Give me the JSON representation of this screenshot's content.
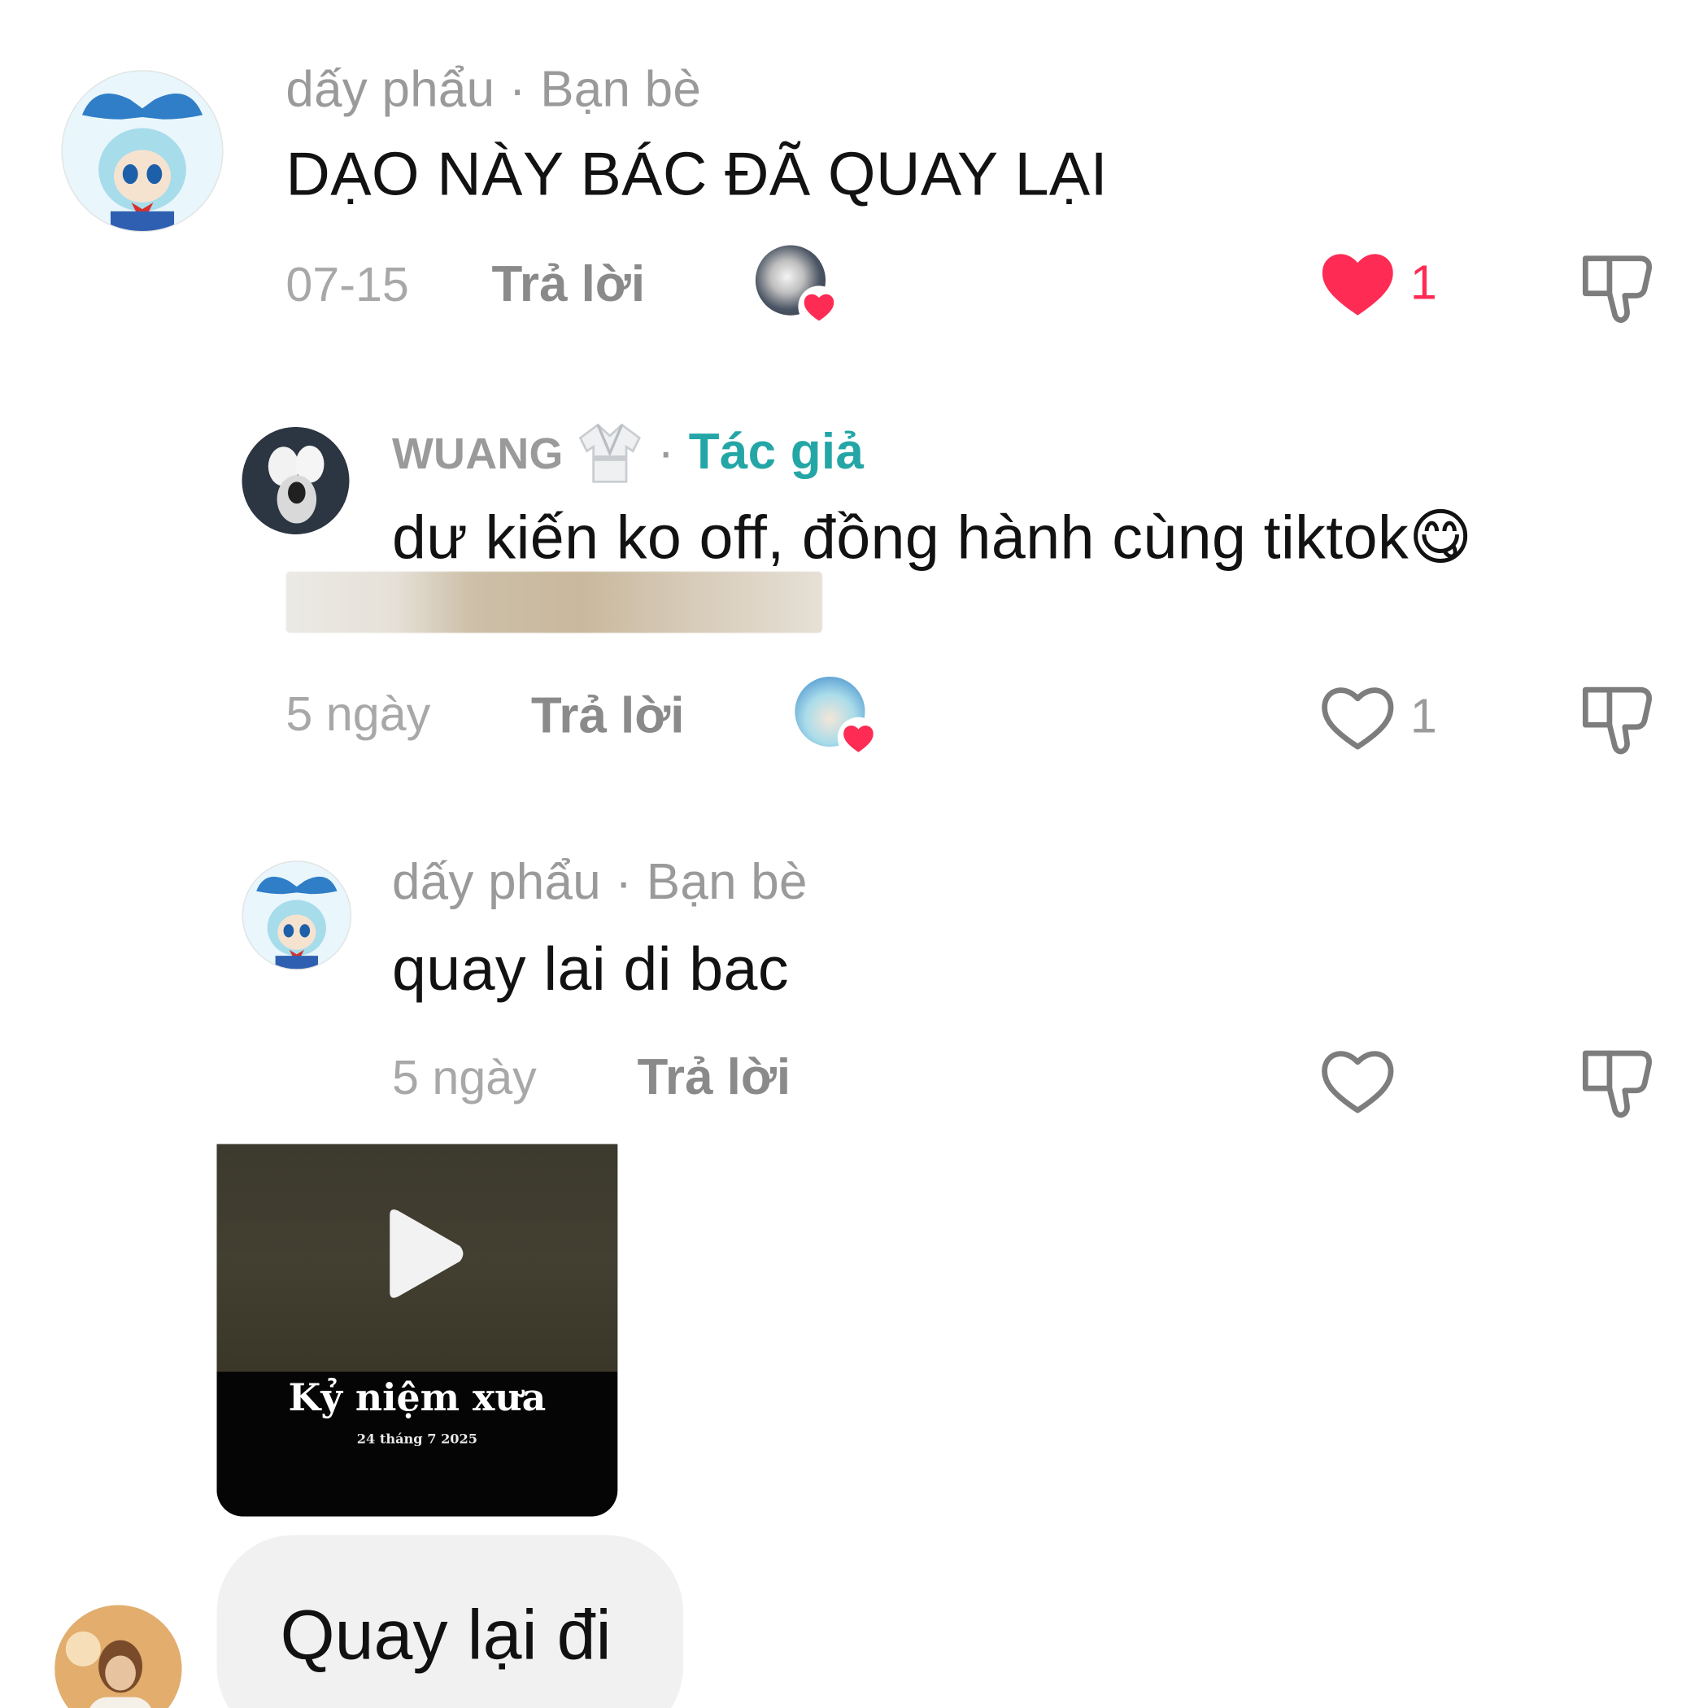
{
  "comment1": {
    "author": "dấy phẩu",
    "separator": "·",
    "relation": "Bạn bè",
    "text": "DẠO NÀY BÁC ĐÃ QUAY LẠI",
    "time": "07-15",
    "reply_label": "Trả lời",
    "like_count": "1",
    "liked": true
  },
  "reply1": {
    "author": "WUANG",
    "author_badge_icon": "karate-gi-icon",
    "separator": "·",
    "relation": "Tác giả",
    "text": "dư kiến ko off, đồng hành cùng tiktok",
    "emoji": "😋",
    "time": "5 ngày",
    "reply_label": "Trả lời",
    "like_count": "1",
    "liked": false
  },
  "reply2": {
    "author": "dấy phẩu",
    "separator": "·",
    "relation": "Bạn bè",
    "text": "quay lai di bac",
    "time": "5 ngày",
    "reply_label": "Trả lời",
    "liked": false
  },
  "video_card": {
    "title": "Kỷ niệm xưa",
    "date": "24 tháng 7 2025"
  },
  "bubble": {
    "text": "Quay lại đi"
  },
  "colors": {
    "heart_red": "#fe2c55",
    "author_teal": "#24a6a6",
    "meta_gray": "#9a9a9a"
  }
}
